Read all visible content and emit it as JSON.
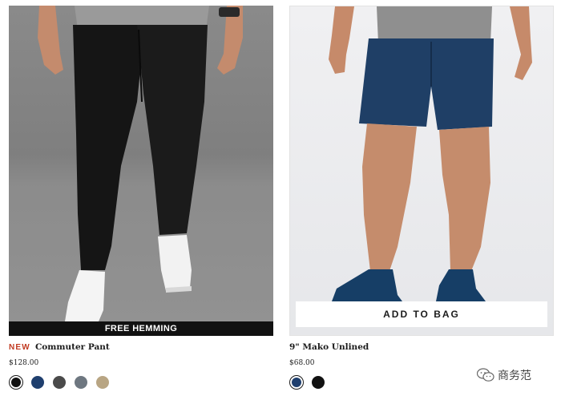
{
  "products": [
    {
      "badge": "NEW",
      "name": "Commuter Pant",
      "price": "$128.00",
      "ribbon": "FREE HEMMING",
      "swatches": [
        {
          "color": "#111111",
          "selected": true
        },
        {
          "color": "#1f3f6e",
          "selected": false
        },
        {
          "color": "#4a4a4a",
          "selected": false
        },
        {
          "color": "#6e7780",
          "selected": false
        },
        {
          "color": "#b8a583",
          "selected": false
        }
      ]
    },
    {
      "name": "9\" Mako Unlined",
      "price": "$68.00",
      "cta": "ADD TO BAG",
      "swatches": [
        {
          "color": "#1f3f6e",
          "selected": true
        },
        {
          "color": "#111111",
          "selected": false
        }
      ]
    }
  ],
  "watermark": {
    "text": "商务范",
    "icon": "wechat-icon"
  },
  "colors": {
    "badge": "#c23b22",
    "ribbon_bg": "#111111"
  }
}
